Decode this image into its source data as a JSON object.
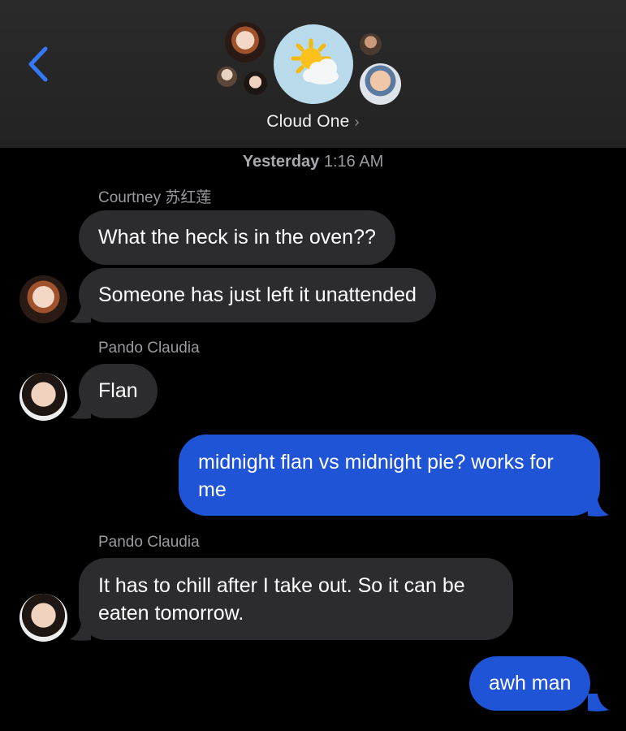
{
  "header": {
    "back_icon": "chevron-left-icon",
    "group_name": "Cloud One",
    "group_icon": "sun-behind-cloud-icon",
    "chevron": "›",
    "colors": {
      "background": "#262626",
      "accent": "#3478f6"
    }
  },
  "conversation": {
    "timestamp_day": "Yesterday",
    "timestamp_time": "1:16 AM",
    "messages": [
      {
        "sender": "Courtney 苏红莲",
        "text": "What the heck is in the oven??",
        "direction": "incoming"
      },
      {
        "text": "Someone has just left it unattended",
        "direction": "incoming"
      },
      {
        "sender": "Pando Claudia",
        "text": "Flan",
        "direction": "incoming"
      },
      {
        "text": "midnight flan vs midnight pie? works for me",
        "direction": "outgoing"
      },
      {
        "sender": "Pando Claudia",
        "text": "It has to chill after I take out. So it can be eaten tomorrow.",
        "direction": "incoming"
      },
      {
        "text": "awh man",
        "direction": "outgoing"
      }
    ],
    "colors": {
      "incoming_bubble": "#2c2c2e",
      "outgoing_bubble": "#1f54d6",
      "meta_text": "#9a9a9f"
    }
  }
}
